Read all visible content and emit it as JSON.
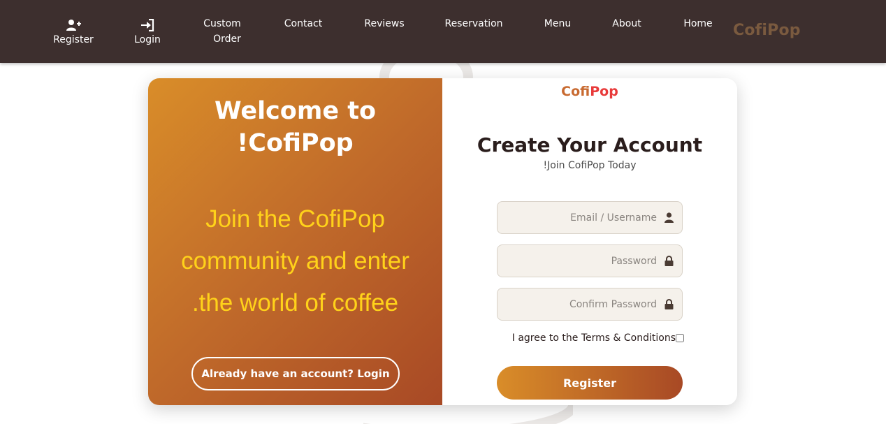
{
  "nav": {
    "register_label": "Register",
    "login_label": "Login",
    "custom_order_line1": "Custom",
    "custom_order_line2": "Order",
    "contact_label": "Contact",
    "reviews_label": "Reviews",
    "reservation_label": "Reservation",
    "menu_label": "Menu",
    "about_label": "About",
    "home_label": "Home",
    "brand": "CofiPop",
    "register_icon": "user-plus-icon",
    "login_icon": "sign-in-icon"
  },
  "left": {
    "welcome_line1": "Welcome to",
    "welcome_line2": "!CofiPop",
    "tagline_line1": "Join the CofiPop",
    "tagline_line2": "community and enter",
    "tagline_line3": ".the world of coffee",
    "login_button": "Already have an account? Login"
  },
  "form": {
    "logo_part1": "Cofi",
    "logo_part2": "Pop",
    "title": "Create Your Account",
    "subtitle": "!Join CofiPop Today",
    "email_placeholder": "Email / Username",
    "password_placeholder": "Password",
    "confirm_placeholder": "Confirm Password",
    "agree_text": "I agree to the Terms & Conditions",
    "register_button": "Register",
    "email_icon": "user-icon",
    "password_icon": "lock-icon",
    "confirm_icon": "lock-icon"
  },
  "colors": {
    "navbar": "#3d2f2e",
    "gradient_start": "#d98d29",
    "gradient_end": "#a84925",
    "tagline": "#ffd21a",
    "brand_nav": "#7a5a3f"
  }
}
